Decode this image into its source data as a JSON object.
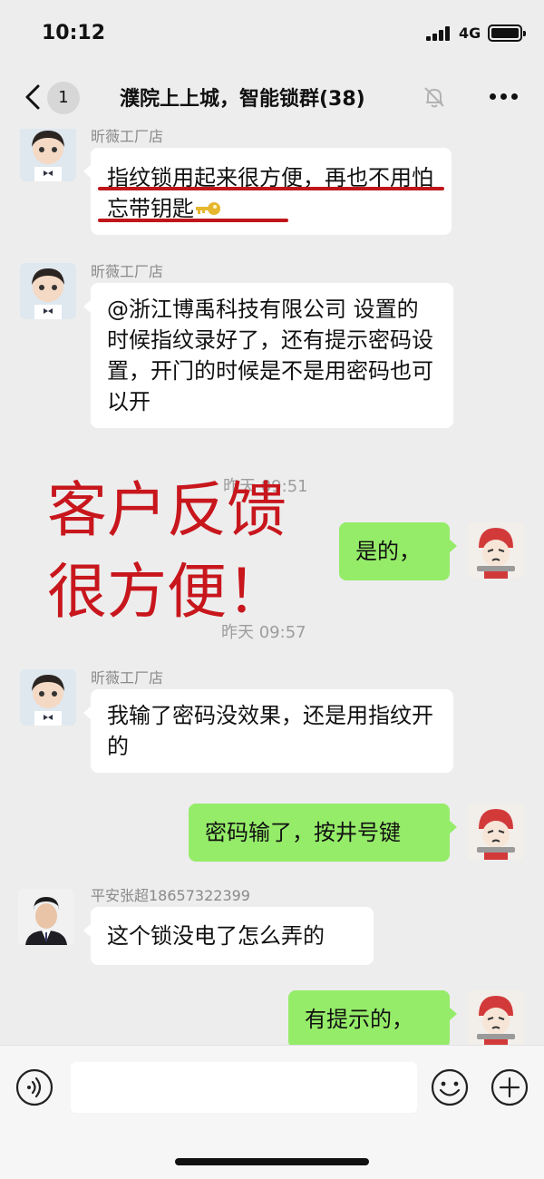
{
  "status_bar": {
    "time": "10:12",
    "network": "4G"
  },
  "nav": {
    "back_badge": "1",
    "title": "濮院上上城，智能锁群(38)"
  },
  "icons": {
    "back": "chevron-left-icon",
    "mute": "bell-off-icon",
    "more": "more-dots-icon",
    "voice": "voice-icon",
    "emoji": "smiley-icon",
    "plus": "plus-icon",
    "key": "key-icon"
  },
  "colors": {
    "background": "#ededed",
    "bubble_in": "#ffffff",
    "bubble_out": "#95ec69",
    "annotation": "#c8161d"
  },
  "messages": [
    {
      "sender": "昕薇工厂店",
      "text": "指纹锁用起来很方便，再也不用怕忘带钥匙",
      "direction": "in"
    },
    {
      "sender": "昕薇工厂店",
      "text": "@浙江博禹科技有限公司 设置的时候指纹录好了，还有提示密码设置，开门的时候是不是用密码也可以开",
      "direction": "in"
    },
    {
      "timestamp": "昨天 09:51"
    },
    {
      "text": "是的，",
      "direction": "out"
    },
    {
      "timestamp": "昨天 09:57"
    },
    {
      "sender": "昕薇工厂店",
      "text": "我输了密码没效果，还是用指纹开的",
      "direction": "in"
    },
    {
      "text": "密码输了，按井号键",
      "direction": "out"
    },
    {
      "sender": "平安张超18657322399",
      "text": "这个锁没电了怎么弄的",
      "direction": "in"
    },
    {
      "text": "有提示的，",
      "direction": "out"
    }
  ],
  "overlay": {
    "line1": "客户反馈",
    "line2": "很方便！"
  },
  "input": {
    "placeholder": ""
  }
}
